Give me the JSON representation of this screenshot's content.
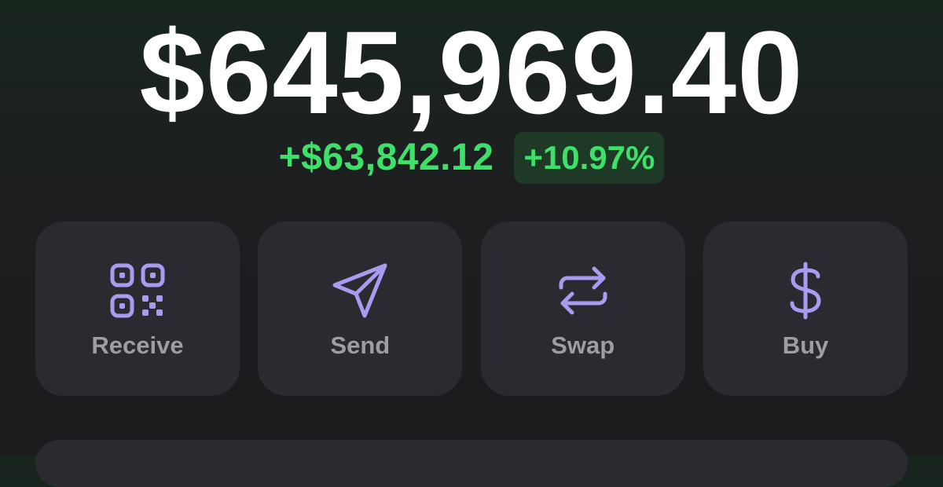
{
  "balance": {
    "total": "$645,969.40",
    "change_amount": "+$63,842.12",
    "change_percent": "+10.97%"
  },
  "actions": [
    {
      "label": "Receive",
      "icon": "qr-code-icon"
    },
    {
      "label": "Send",
      "icon": "paper-plane-icon"
    },
    {
      "label": "Swap",
      "icon": "swap-arrows-icon"
    },
    {
      "label": "Buy",
      "icon": "dollar-icon"
    }
  ],
  "colors": {
    "positive": "#3ee06a",
    "accent": "#a99cf0",
    "card": "#2b2a31",
    "label": "#9e9da4"
  }
}
